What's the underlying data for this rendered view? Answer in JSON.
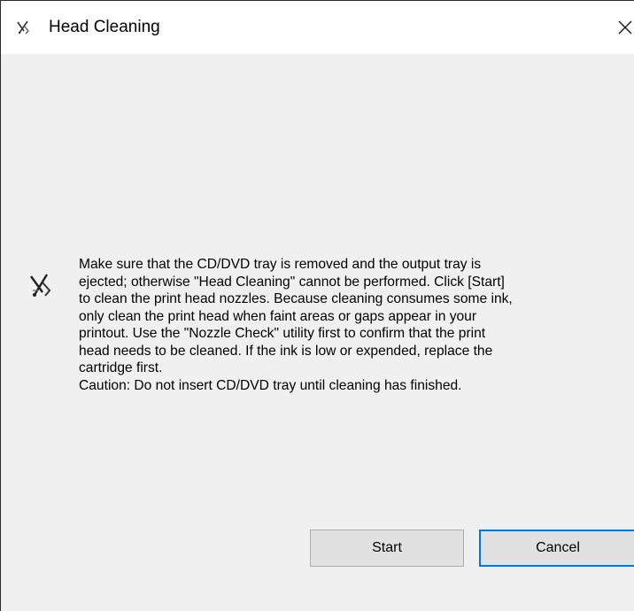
{
  "window": {
    "title": "Head Cleaning",
    "icons": {
      "title": "printer-head-icon",
      "close": "close-icon",
      "message": "printer-head-icon"
    }
  },
  "message": {
    "text": "Make sure that the CD/DVD tray is removed and the output tray is\nejected; otherwise \"Head Cleaning\" cannot be performed. Click [Start]\nto clean the print head nozzles. Because cleaning consumes some ink,\nonly clean the print head when faint areas or gaps appear in your\nprintout. Use the \"Nozzle Check\" utility first to confirm that the print\nhead needs to be cleaned. If the ink is low or expended, replace the\ncartridge first.\nCaution: Do not insert CD/DVD tray until cleaning has finished."
  },
  "buttons": {
    "start": "Start",
    "cancel": "Cancel"
  },
  "colors": {
    "focus_border": "#0078d7",
    "dialog_background": "#f0f0f0",
    "button_face": "#e1e1e1"
  }
}
